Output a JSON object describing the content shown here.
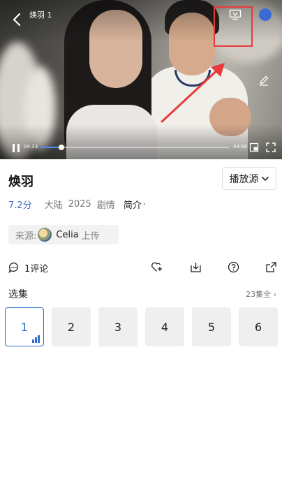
{
  "player": {
    "title": "焕羽 1",
    "current_time": "04:33",
    "total_time": "44:56",
    "progress_fraction": 0.11,
    "accent_color": "#4a8dff",
    "icons": [
      "back-icon",
      "cast-icon",
      "profile-icon",
      "edit-icon",
      "pause-icon",
      "pip-icon",
      "fullscreen-icon"
    ],
    "annotation_color": "#e83a3a"
  },
  "show": {
    "title": "焕羽",
    "source_button": "播放源",
    "rating": "7.2分",
    "region": "大陆",
    "year": "2025",
    "genre": "剧情",
    "intro_link": "简介"
  },
  "source_chip": {
    "label": "来源:",
    "uploader": "Celia",
    "suffix": "上传"
  },
  "actions": {
    "comments": "1评论",
    "icons": [
      "comment-icon",
      "favorite-icon",
      "download-icon",
      "help-icon",
      "share-icon"
    ]
  },
  "episodes": {
    "label": "选集",
    "total": "23集全",
    "items": [
      "1",
      "2",
      "3",
      "4",
      "5",
      "6"
    ],
    "active_index": 0
  }
}
